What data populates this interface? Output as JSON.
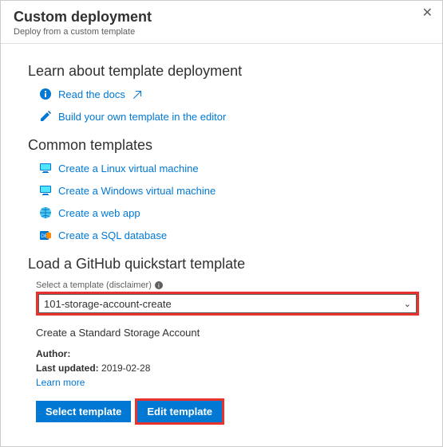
{
  "header": {
    "title": "Custom deployment",
    "subtitle": "Deploy from a custom template",
    "close_glyph": "✕"
  },
  "sections": {
    "learn": {
      "title": "Learn about template deployment",
      "links": {
        "read_docs": "Read the docs",
        "build_own": "Build your own template in the editor"
      }
    },
    "common": {
      "title": "Common templates",
      "links": {
        "linux_vm": "Create a Linux virtual machine",
        "windows_vm": "Create a Windows virtual machine",
        "web_app": "Create a web app",
        "sql_db": "Create a SQL database"
      }
    },
    "github": {
      "title": "Load a GitHub quickstart template",
      "select_label": "Select a template (disclaimer)",
      "selected_value": "101-storage-account-create",
      "description": "Create a Standard Storage Account",
      "author_label": "Author:",
      "updated_label": "Last updated:",
      "updated_value": "2019-02-28",
      "learn_more": "Learn more",
      "buttons": {
        "select": "Select template",
        "edit": "Edit template"
      }
    }
  },
  "icons": {
    "info": "info-icon",
    "edit": "pencil-icon",
    "monitor": "monitor-icon",
    "globe": "globe-icon",
    "db": "db-icon",
    "external": "external-link-icon",
    "tooltip": "i"
  },
  "colors": {
    "link": "#0078d4",
    "highlight": "#e8322e",
    "accent_blue": "#0078d4",
    "accent_orange": "#ff8c00"
  }
}
